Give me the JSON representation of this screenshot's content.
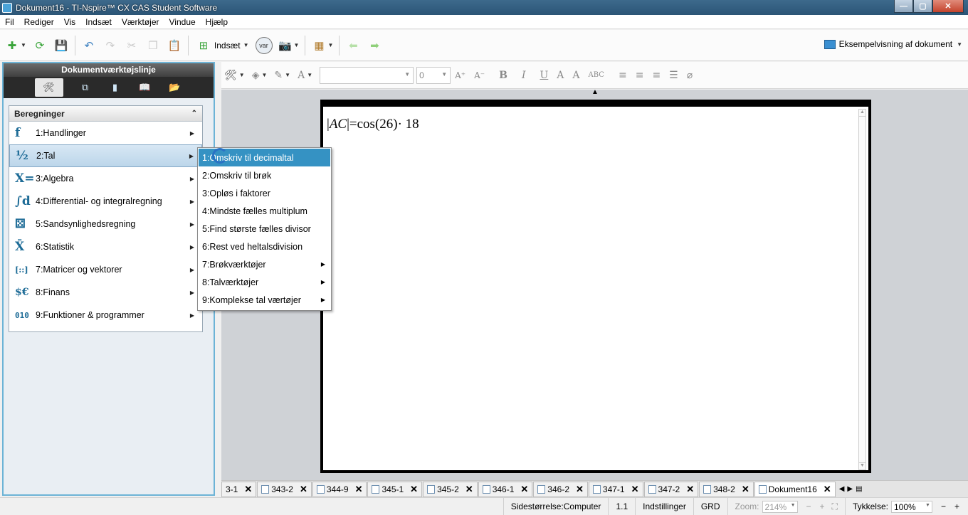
{
  "window": {
    "title": "Dokument16 - TI-Nspire™ CX CAS Student Software"
  },
  "menubar": [
    "Fil",
    "Rediger",
    "Vis",
    "Indsæt",
    "Værktøjer",
    "Vindue",
    "Hjælp"
  ],
  "toolbar": {
    "insert_label": "Indsæt",
    "var_label": "var",
    "preview_label": "Eksempelvisning af dokument"
  },
  "left_panel": {
    "title": "Dokumentværktøjslinje",
    "section_title": "Beregninger",
    "items": [
      {
        "icon": "f",
        "label": "1:Handlinger"
      },
      {
        "icon": "½",
        "label": "2:Tal"
      },
      {
        "icon": "X=",
        "label": "3:Algebra"
      },
      {
        "icon": "∫d",
        "label": "4:Differential- og integralregning"
      },
      {
        "icon": "⚄",
        "label": "5:Sandsynlighedsregning"
      },
      {
        "icon": "X̄",
        "label": "6:Statistik"
      },
      {
        "icon": "[::]",
        "label": "7:Matricer og vektorer"
      },
      {
        "icon": "$€",
        "label": "8:Finans"
      },
      {
        "icon": "010",
        "label": "9:Funktioner & programmer"
      }
    ]
  },
  "submenu": {
    "items": [
      {
        "label": "1:Omskriv til decimaltal"
      },
      {
        "label": "2:Omskriv til brøk"
      },
      {
        "label": "3:Opløs i faktorer"
      },
      {
        "label": "4:Mindste fælles multiplum"
      },
      {
        "label": "5:Find største fælles divisor"
      },
      {
        "label": "6:Rest ved heltalsdivision"
      },
      {
        "label": "7:Brøkværktøjer"
      },
      {
        "label": "8:Talværktøjer"
      },
      {
        "label": "9:Komplekse tal værtøjer"
      }
    ]
  },
  "format_bar": {
    "font_size": "0",
    "bold": "B",
    "italic": "I",
    "underline": "U",
    "superscript": "A",
    "subscript": "A",
    "caps": "ABC"
  },
  "document": {
    "expr_var": "AC",
    "expr_rest": "=cos(26)· 18"
  },
  "page_tabs": [
    "3-1",
    "343-2",
    "344-9",
    "345-1",
    "345-2",
    "346-1",
    "346-2",
    "347-1",
    "347-2",
    "348-2",
    "Dokument16"
  ],
  "status": {
    "page_size": "Sidestørrelse:Computer",
    "page_num": "1.1",
    "settings": "Indstillinger",
    "angle": "GRD",
    "zoom_label": "Zoom:",
    "zoom_value": "214%",
    "thickness_label": "Tykkelse:",
    "thickness_value": "100%"
  }
}
